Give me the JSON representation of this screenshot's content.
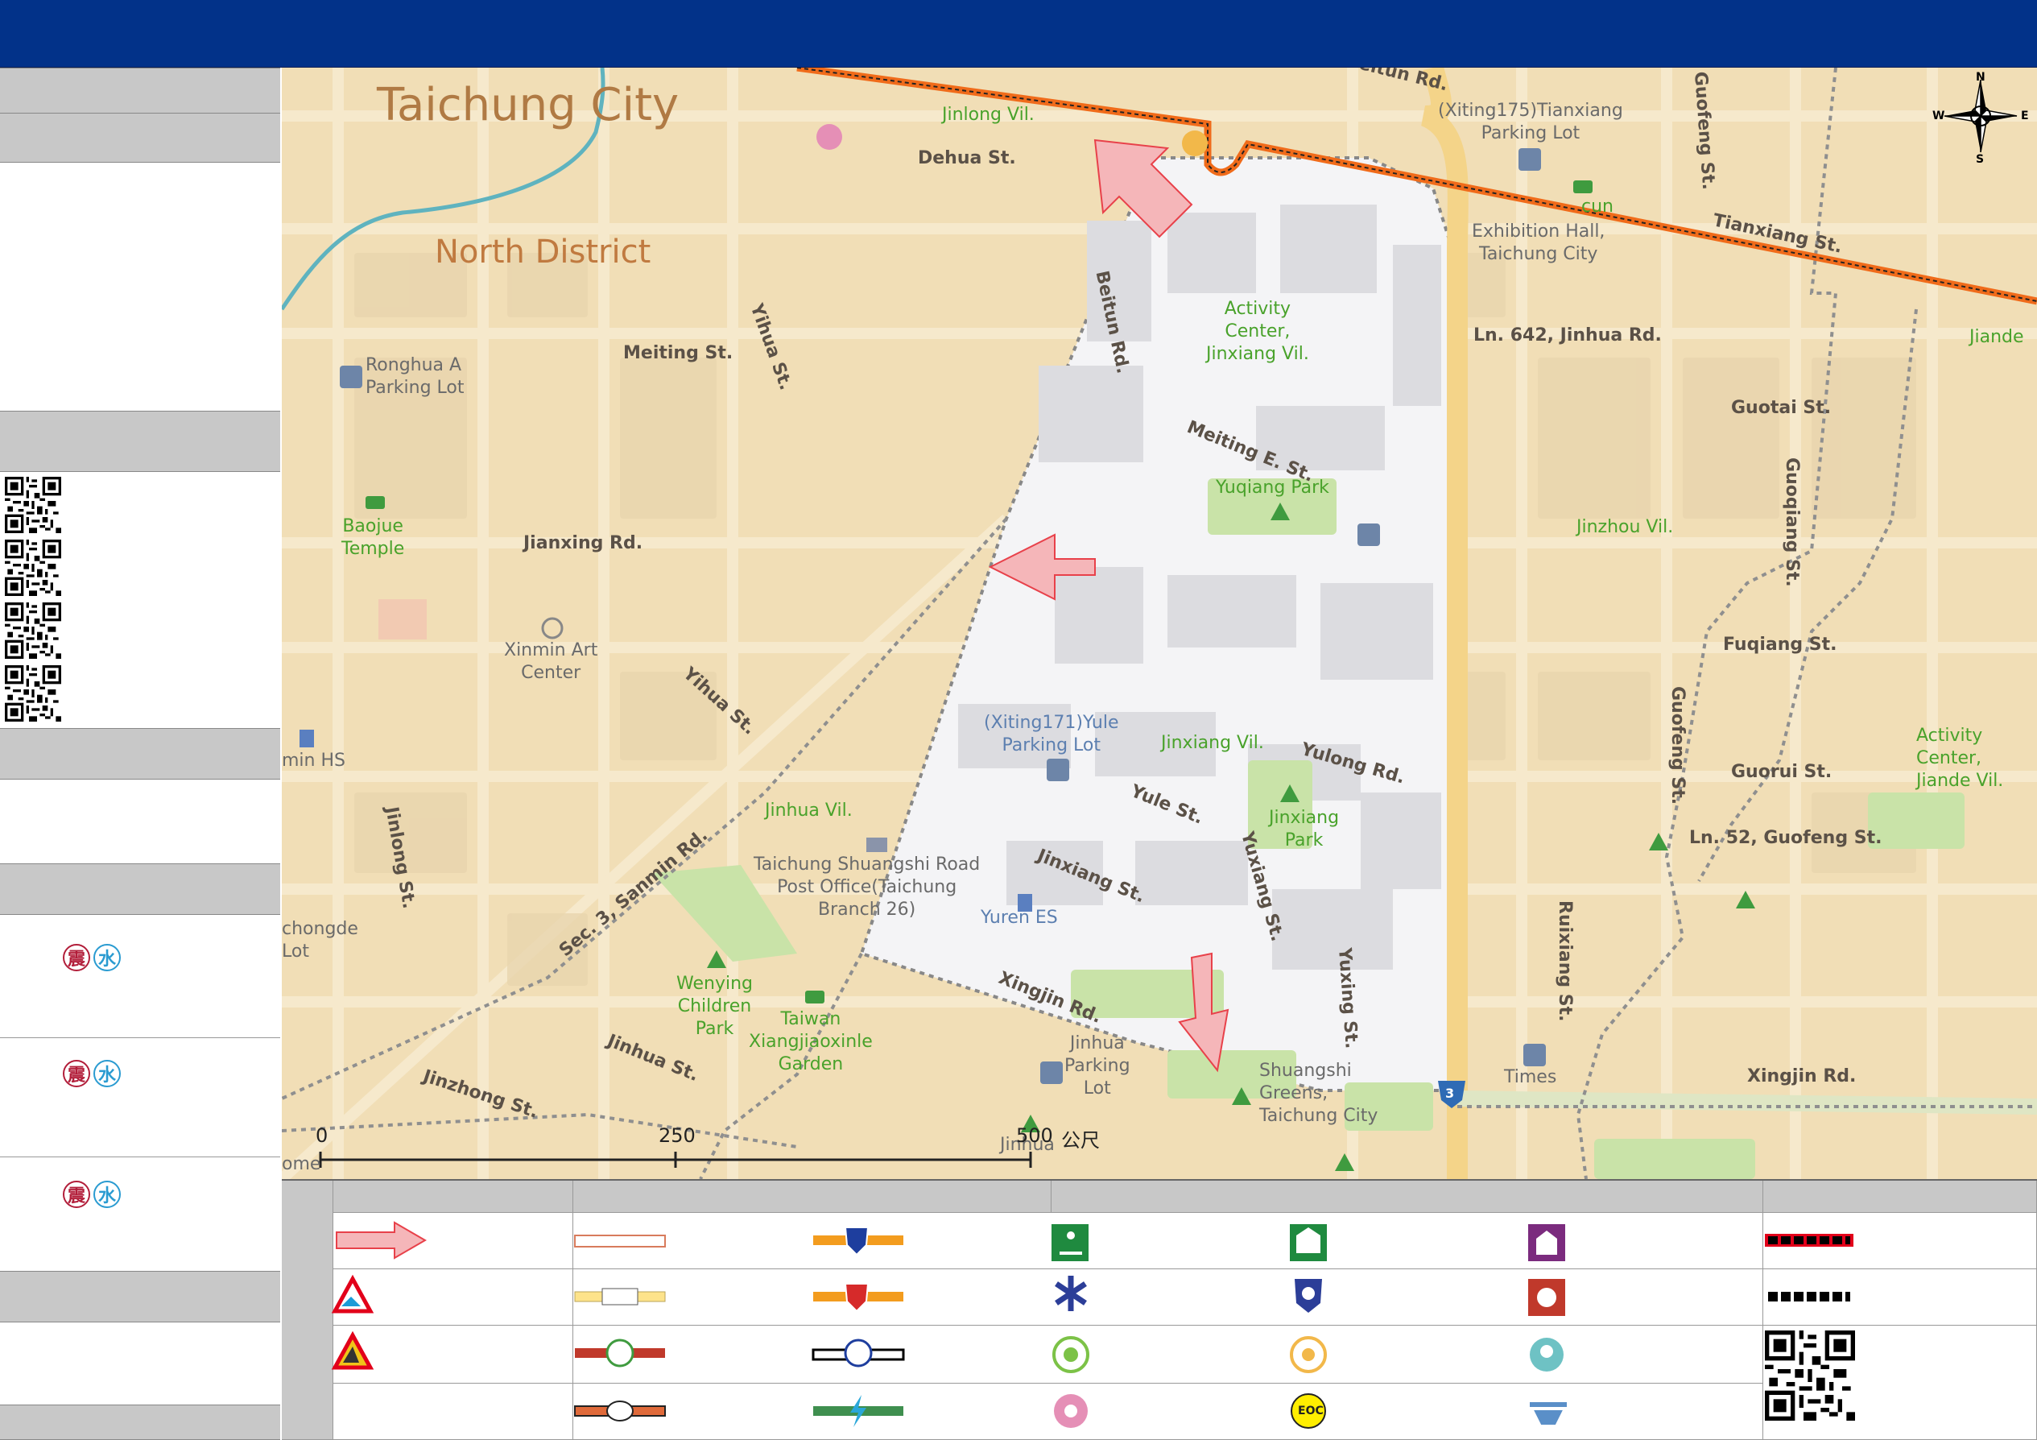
{
  "colors": {
    "header_bar": "#023289",
    "sidebar_header": "#c8c8c8",
    "map_background": "#f1deb6",
    "district_boundary": "#f06b1a",
    "highlight_area": "#f4f4f6",
    "evacuation_arrow": "#e8414a",
    "quake_badge": "#b21e3a",
    "flood_badge": "#2a9bd1"
  },
  "sidebar": {
    "qr_codes": [
      "qr-code-icon",
      "qr-code-icon",
      "qr-code-icon",
      "qr-code-icon"
    ],
    "hazard_rows": [
      {
        "quake": "震",
        "flood": "水"
      },
      {
        "quake": "震",
        "flood": "水"
      },
      {
        "quake": "震",
        "flood": "水"
      }
    ]
  },
  "map": {
    "city_label": "Taichung City",
    "district_label": "North District",
    "villages": [
      "Jinlong Vil.",
      "Jinxiang Vil.",
      "Jinzhou Vil.",
      "Jinhua Vil.",
      "Jiande"
    ],
    "roads": {
      "dehua": "Dehua St.",
      "beitun": "Beitun Rd.",
      "beitun_top": "Beitun Rd.",
      "yihua": "Yihua St.",
      "yihua2": "Yihua St.",
      "meiting": "Meiting St.",
      "meiting_e": "Meiting E. St.",
      "jianxing": "Jianxing Rd.",
      "guofeng": "Guofeng St.",
      "guofeng2": "Guofeng St.",
      "tianxiang": "Tianxiang St.",
      "ln642": "Ln. 642, Jinhua Rd.",
      "guotai": "Guotai St.",
      "guoqiang": "Guoqiang St.",
      "fuqiang": "Fuqiang St.",
      "guorui": "Guorui St.",
      "ln52": "Ln. 52, Guofeng St.",
      "yulong": "Yulong Rd.",
      "yule": "Yule St.",
      "jinxiang": "Jinxiang St.",
      "yuxiang": "Yuxiang St.",
      "yuxing": "Yuxing St.",
      "xingjin": "Xingjin Rd.",
      "xingjin2": "Xingjin Rd.",
      "ruixiang": "Ruixiang St.",
      "sanmin": "Sec. 3, Sanmin Rd.",
      "jinhua": "Jinhua St.",
      "jinzhong": "Jinzhong St.",
      "jinlong_st": "Jinlong St."
    },
    "pois": {
      "tianxiang_lot": "(Xiting175)Tianxiang\nParking Lot",
      "exhibition": "Exhibition Hall,\nTaichung City",
      "activity_jinxiang": "Activity\nCenter,\nJinxiang Vil.",
      "ronghua": "Ronghua A\nParking Lot",
      "yuqiang": "Yuqiang Park",
      "baojue": "Baojue\nTemple",
      "xinmin": "Xinmin Art\nCenter",
      "yule_lot": "(Xiting171)Yule\nParking Lot",
      "jinxiang_park": "Jinxiang\nPark",
      "post_office": "Taichung Shuangshi Road\nPost Office(Taichung\nBranch 26)",
      "yuren": "Yuren ES",
      "wenying": "Wenying\nChildren\nPark",
      "xiangjiaoxinle": "Taiwan\nXiangjiaoxinle\nGarden",
      "jinhua_lot": "Jinhua\nParking\nLot",
      "shuangshi": "Shuangshi\nGreens,\nTaichung City",
      "activity_jiande": "Activity\nCenter,\nJiande Vil.",
      "times": "Times",
      "xinmin_hs": "min HS",
      "chongde": "chongde\nLot",
      "jinhua_bottom": "Jinhua",
      "cun": "cun",
      "ome": "ome",
      "route_shield": "3"
    },
    "scale_bar": {
      "ticks": [
        "0",
        "250",
        "500"
      ],
      "unit": "公尺"
    },
    "compass": {
      "n": "N",
      "s": "S",
      "e": "E",
      "w": "W"
    }
  },
  "legend": {
    "items": [
      "evacuation-direction-arrow",
      "landslide-warning-icon",
      "debris-flow-warning-icon",
      "highway-road-line",
      "provincial-road-line",
      "county-road-line",
      "township-road-line",
      "national-highway-shield",
      "provincial-highway-shield",
      "railway-line",
      "high-speed-rail-line",
      "evacuation-site-icon",
      "medical-emergency-icon",
      "elderly-care-icon",
      "child-welfare-icon",
      "shelter-icon",
      "police-icon",
      "senior-center-icon",
      "eoc-icon",
      "disabled-welfare-icon",
      "fire-station-icon",
      "family-service-icon",
      "helicopter-icon",
      "boundary-red-line",
      "boundary-black-line",
      "qr-code-icon"
    ],
    "eoc_label": "EOC"
  }
}
